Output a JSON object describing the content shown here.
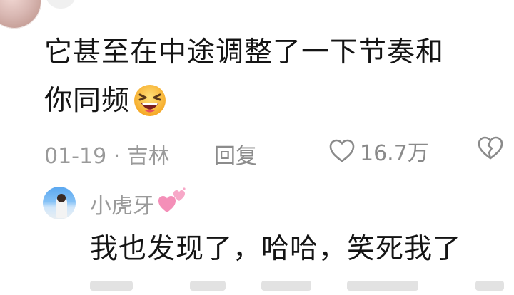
{
  "comment": {
    "text_line1": "它甚至在中途调整了一下节奏和",
    "text_line2": "你同频",
    "emoji": "laughing-face",
    "time_location": "01-19 · 吉林",
    "reply_label": "回复",
    "like_count": "16.7万"
  },
  "reply": {
    "username": "小虎牙",
    "name_emoji": "pink-hearts",
    "text": "我也发现了，哈哈，笑死我了"
  },
  "colors": {
    "text": "#141414",
    "meta": "#9a9a9a",
    "hearts": "#f48fb8"
  }
}
